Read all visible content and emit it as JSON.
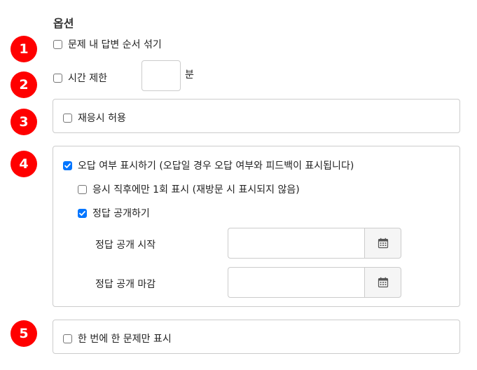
{
  "section": {
    "title": "옵션"
  },
  "markers": [
    "1",
    "2",
    "3",
    "4",
    "5"
  ],
  "options": {
    "shuffle": {
      "label": "문제 내 답변 순서 섞기",
      "checked": false
    },
    "time_limit": {
      "label": "시간 제한",
      "checked": false,
      "value": "",
      "unit": "분"
    },
    "retake": {
      "label": "재응시 허용",
      "checked": false
    },
    "show_correctness": {
      "label": "오답 여부 표시하기 (오답일 경우 오답 여부와 피드백이 표시됩니다)",
      "checked": true,
      "only_once": {
        "label": "응시 직후에만 1회 표시 (재방문 시 표시되지 않음)",
        "checked": false
      },
      "reveal_answers": {
        "label": "정답 공개하기",
        "checked": true
      },
      "reveal_start": {
        "label": "정답 공개 시작",
        "value": ""
      },
      "reveal_end": {
        "label": "정답 공개 마감",
        "value": ""
      }
    },
    "one_at_a_time": {
      "label": "한 번에 한 문제만 표시",
      "checked": false
    }
  },
  "icons": {
    "checkmark": "check-icon",
    "calendar": "calendar-icon"
  },
  "colors": {
    "marker": "#ff0000",
    "checkbox_checked": "#0075ff",
    "border": "#cccccc"
  }
}
